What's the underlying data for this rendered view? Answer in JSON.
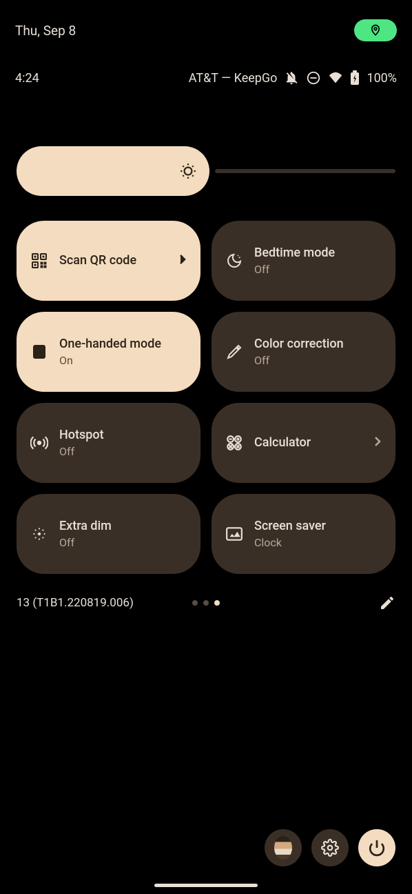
{
  "top": {
    "date": "Thu, Sep 8"
  },
  "status": {
    "time": "4:24",
    "carrier": "AT&T — KeepGo",
    "battery": "100%"
  },
  "tiles": [
    {
      "title": "Scan QR code",
      "subtitle": "",
      "active": true,
      "chevron": true
    },
    {
      "title": "Bedtime mode",
      "subtitle": "Off",
      "active": false,
      "chevron": false
    },
    {
      "title": "One-handed mode",
      "subtitle": "On",
      "active": true,
      "chevron": false
    },
    {
      "title": "Color correction",
      "subtitle": "Off",
      "active": false,
      "chevron": false
    },
    {
      "title": "Hotspot",
      "subtitle": "Off",
      "active": false,
      "chevron": false
    },
    {
      "title": "Calculator",
      "subtitle": "",
      "active": false,
      "chevron": true
    },
    {
      "title": "Extra dim",
      "subtitle": "Off",
      "active": false,
      "chevron": false
    },
    {
      "title": "Screen saver",
      "subtitle": "Clock",
      "active": false,
      "chevron": false
    }
  ],
  "build": "13 (T1B1.220819.006)",
  "pagination": {
    "total": 3,
    "current": 2
  }
}
